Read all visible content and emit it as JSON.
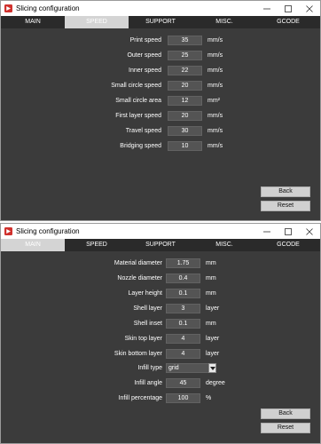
{
  "windows": [
    {
      "title": "Slicing configuration",
      "tabs": [
        {
          "label": "MAIN"
        },
        {
          "label": "SPEED"
        },
        {
          "label": "SUPPORT"
        },
        {
          "label": "MISC."
        },
        {
          "label": "GCODE"
        }
      ],
      "active_tab": "SPEED",
      "fields": [
        {
          "label": "Print speed",
          "value": "35",
          "unit": "mm/s"
        },
        {
          "label": "Outer speed",
          "value": "25",
          "unit": "mm/s"
        },
        {
          "label": "Inner speed",
          "value": "22",
          "unit": "mm/s"
        },
        {
          "label": "Small circle speed",
          "value": "20",
          "unit": "mm/s"
        },
        {
          "label": "Small circle area",
          "value": "12",
          "unit": "mm²"
        },
        {
          "label": "First layer speed",
          "value": "20",
          "unit": "mm/s"
        },
        {
          "label": "Travel speed",
          "value": "30",
          "unit": "mm/s"
        },
        {
          "label": "Bridging speed",
          "value": "10",
          "unit": "mm/s"
        }
      ],
      "buttons": {
        "back": "Back",
        "reset": "Reset"
      }
    },
    {
      "title": "Slicing configuration",
      "tabs": [
        {
          "label": "MAIN"
        },
        {
          "label": "SPEED"
        },
        {
          "label": "SUPPORT"
        },
        {
          "label": "MISC."
        },
        {
          "label": "GCODE"
        }
      ],
      "active_tab": "MAIN",
      "fields": [
        {
          "label": "Material diameter",
          "value": "1.75",
          "unit": "mm"
        },
        {
          "label": "Nozzle diameter",
          "value": "0.4",
          "unit": "mm"
        },
        {
          "label": "Layer height",
          "value": "0.1",
          "unit": "mm"
        },
        {
          "label": "Shell layer",
          "value": "3",
          "unit": "layer"
        },
        {
          "label": "Shell inset",
          "value": "0.1",
          "unit": "mm"
        },
        {
          "label": "Skin top layer",
          "value": "4",
          "unit": "layer"
        },
        {
          "label": "Skin bottom layer",
          "value": "4",
          "unit": "layer"
        }
      ],
      "infill_type": {
        "label": "Infill type",
        "value": "grid"
      },
      "infill_fields": [
        {
          "label": "Infill angle",
          "value": "45",
          "unit": "degree"
        },
        {
          "label": "Infill percentage",
          "value": "100",
          "unit": "%"
        }
      ],
      "buttons": {
        "back": "Back",
        "reset": "Reset"
      }
    }
  ],
  "colors": {
    "window_bg": "#3b3b3b",
    "field_bg": "#545454",
    "active_tab": "#d4d4d4",
    "button": "#d0d0d0",
    "app_icon": "#d0312d"
  },
  "icons": {
    "app": "app-logo-icon",
    "minimize": "minimize-icon",
    "maximize": "maximize-icon",
    "close": "close-icon",
    "dropdown": "chevron-down-icon"
  }
}
